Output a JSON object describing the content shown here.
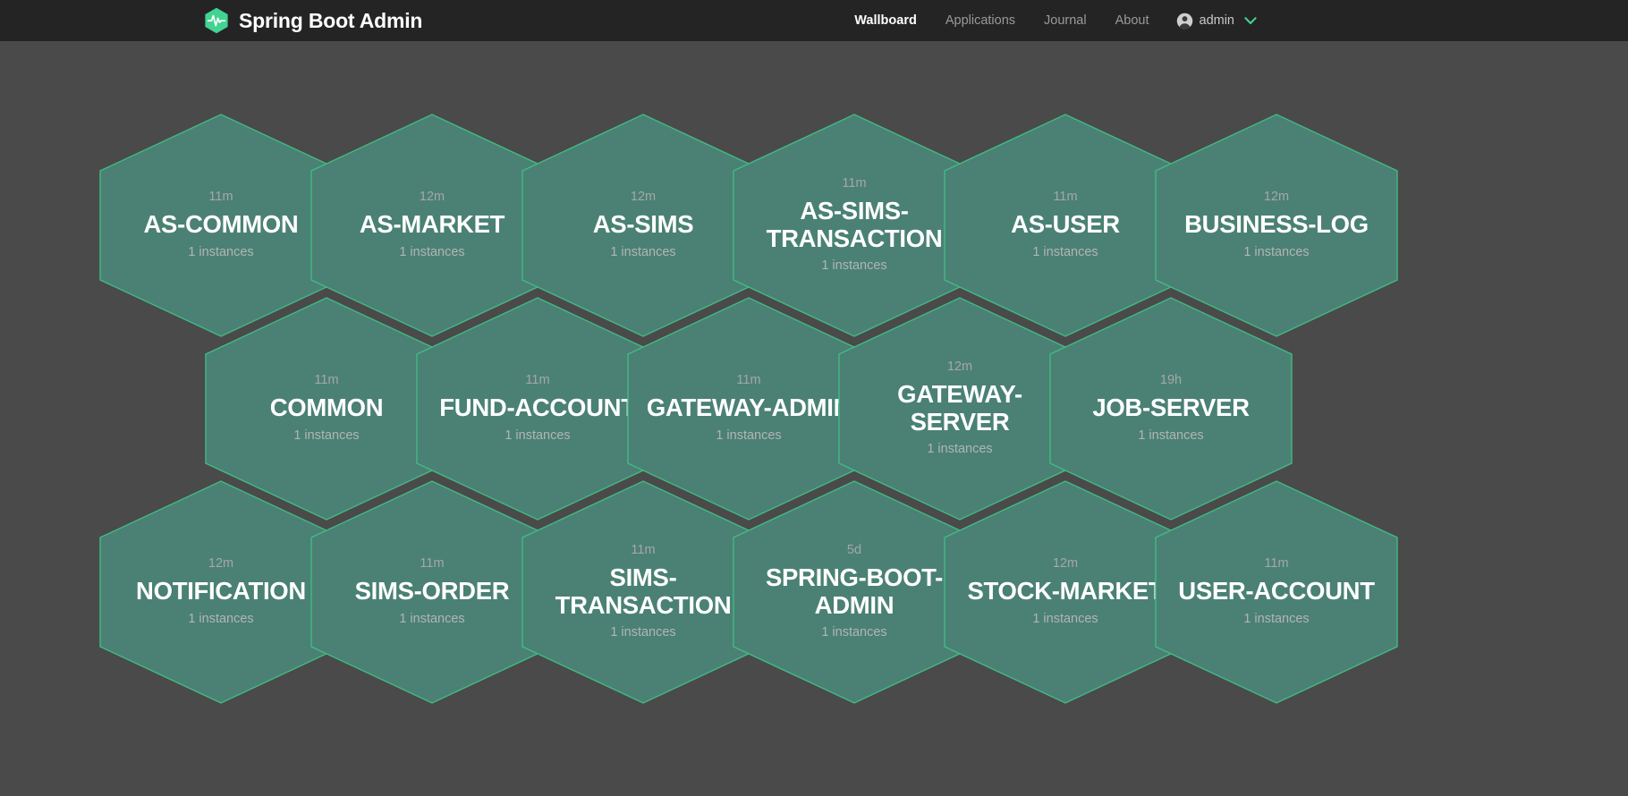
{
  "navbar": {
    "brand_title": "Spring Boot Admin",
    "logo_icon": "heartbeat-hexagon-logo",
    "links": [
      {
        "label": "Wallboard",
        "active": true
      },
      {
        "label": "Applications",
        "active": false
      },
      {
        "label": "Journal",
        "active": false
      },
      {
        "label": "About",
        "active": false
      }
    ],
    "user": {
      "name": "admin",
      "avatar_icon": "user-circle-icon",
      "chevron_icon": "chevron-down-icon"
    }
  },
  "theme": {
    "navbar_bg": "#242424",
    "page_bg": "#4a4a4a",
    "hex_fill": "#4a8174",
    "hex_border": "#42b983",
    "accent": "#42b983",
    "text_primary": "#ffffff",
    "text_muted": "#a7a7a7"
  },
  "wallboard": {
    "instances_suffix": "1 instances",
    "applications": [
      {
        "name": "AS-COMMON",
        "uptime": "11m",
        "instances": "1 instances",
        "row": 0,
        "col": 0
      },
      {
        "name": "AS-MARKET",
        "uptime": "12m",
        "instances": "1 instances",
        "row": 0,
        "col": 1
      },
      {
        "name": "AS-SIMS",
        "uptime": "12m",
        "instances": "1 instances",
        "row": 0,
        "col": 2
      },
      {
        "name": "AS-SIMS-TRANSACTION",
        "uptime": "11m",
        "instances": "1 instances",
        "row": 0,
        "col": 3
      },
      {
        "name": "AS-USER",
        "uptime": "11m",
        "instances": "1 instances",
        "row": 0,
        "col": 4
      },
      {
        "name": "BUSINESS-LOG",
        "uptime": "12m",
        "instances": "1 instances",
        "row": 0,
        "col": 5
      },
      {
        "name": "COMMON",
        "uptime": "11m",
        "instances": "1 instances",
        "row": 1,
        "col": 0
      },
      {
        "name": "FUND-ACCOUNT",
        "uptime": "11m",
        "instances": "1 instances",
        "row": 1,
        "col": 1
      },
      {
        "name": "GATEWAY-ADMIN",
        "uptime": "11m",
        "instances": "1 instances",
        "row": 1,
        "col": 2
      },
      {
        "name": "GATEWAY-SERVER",
        "uptime": "12m",
        "instances": "1 instances",
        "row": 1,
        "col": 3
      },
      {
        "name": "JOB-SERVER",
        "uptime": "19h",
        "instances": "1 instances",
        "row": 1,
        "col": 4
      },
      {
        "name": "NOTIFICATION",
        "uptime": "12m",
        "instances": "1 instances",
        "row": 2,
        "col": 0
      },
      {
        "name": "SIMS-ORDER",
        "uptime": "11m",
        "instances": "1 instances",
        "row": 2,
        "col": 1
      },
      {
        "name": "SIMS-TRANSACTION",
        "uptime": "11m",
        "instances": "1 instances",
        "row": 2,
        "col": 2
      },
      {
        "name": "SPRING-BOOT-ADMIN",
        "uptime": "5d",
        "instances": "1 instances",
        "row": 2,
        "col": 3
      },
      {
        "name": "STOCK-MARKET",
        "uptime": "12m",
        "instances": "1 instances",
        "row": 2,
        "col": 4
      },
      {
        "name": "USER-ACCOUNT",
        "uptime": "11m",
        "instances": "1 instances",
        "row": 2,
        "col": 5
      }
    ]
  }
}
